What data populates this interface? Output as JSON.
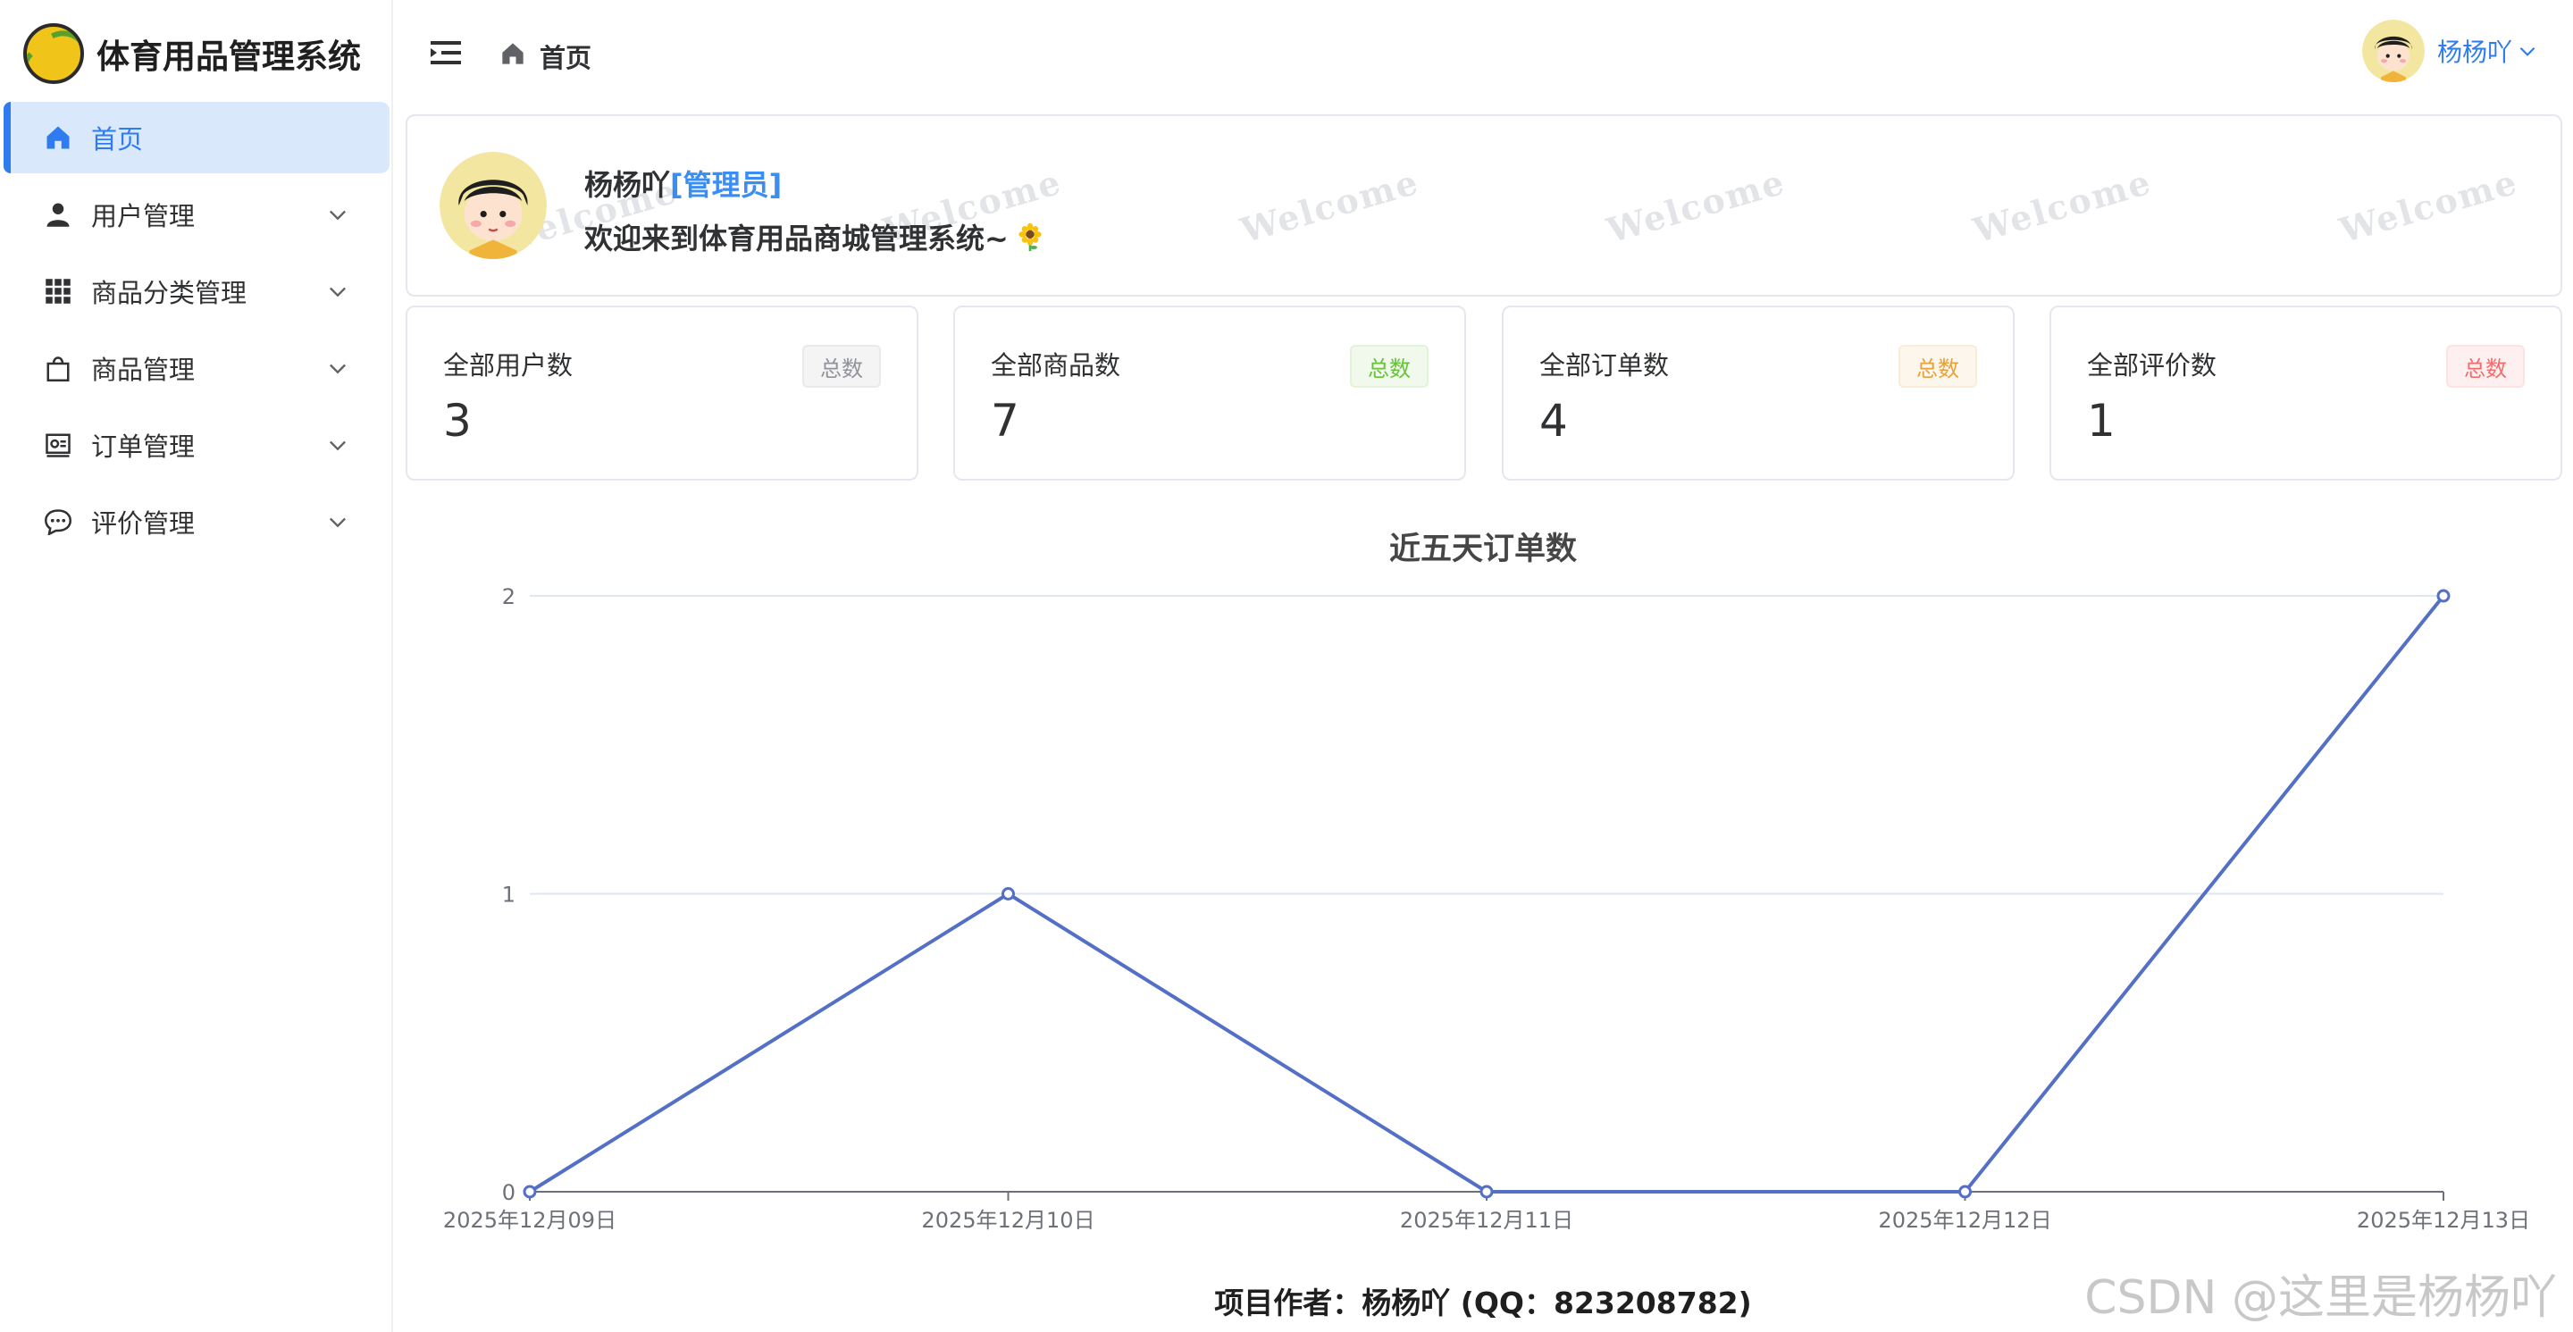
{
  "app": {
    "title": "体育用品管理系统"
  },
  "sidebar": {
    "items": [
      {
        "label": "首页",
        "icon": "home-icon",
        "active": true
      },
      {
        "label": "用户管理",
        "icon": "user-icon",
        "active": false
      },
      {
        "label": "商品分类管理",
        "icon": "grid-icon",
        "active": false
      },
      {
        "label": "商品管理",
        "icon": "bag-icon",
        "active": false
      },
      {
        "label": "订单管理",
        "icon": "order-icon",
        "active": false
      },
      {
        "label": "评价管理",
        "icon": "comment-icon",
        "active": false
      }
    ]
  },
  "header": {
    "breadcrumb": "首页",
    "username": "杨杨吖"
  },
  "welcome": {
    "name": "杨杨吖",
    "role": "[管理员]",
    "message": "欢迎来到体育用品商城管理系统~",
    "watermark": "Welcome"
  },
  "stats": [
    {
      "label": "全部用户数",
      "value": "3",
      "tag": "总数"
    },
    {
      "label": "全部商品数",
      "value": "7",
      "tag": "总数"
    },
    {
      "label": "全部订单数",
      "value": "4",
      "tag": "总数"
    },
    {
      "label": "全部评价数",
      "value": "1",
      "tag": "总数"
    }
  ],
  "chart_data": {
    "type": "line",
    "title": "近五天订单数",
    "categories": [
      "2025年12月09日",
      "2025年12月10日",
      "2025年12月11日",
      "2025年12月12日",
      "2025年12月13日"
    ],
    "series": [
      {
        "values": [
          0,
          1,
          0,
          0,
          2
        ]
      }
    ],
    "yticks": [
      "0",
      "1",
      "2"
    ],
    "ylim": [
      0,
      2
    ],
    "grid": true,
    "line_color": "#5470c6"
  },
  "footer": {
    "author": "项目作者：杨杨吖 (QQ：823208782)"
  },
  "watermark": {
    "text": "CSDN @这里是杨杨吖"
  },
  "colors": {
    "primary": "#2f7cf0",
    "active_bg": "#d9e8fb"
  }
}
